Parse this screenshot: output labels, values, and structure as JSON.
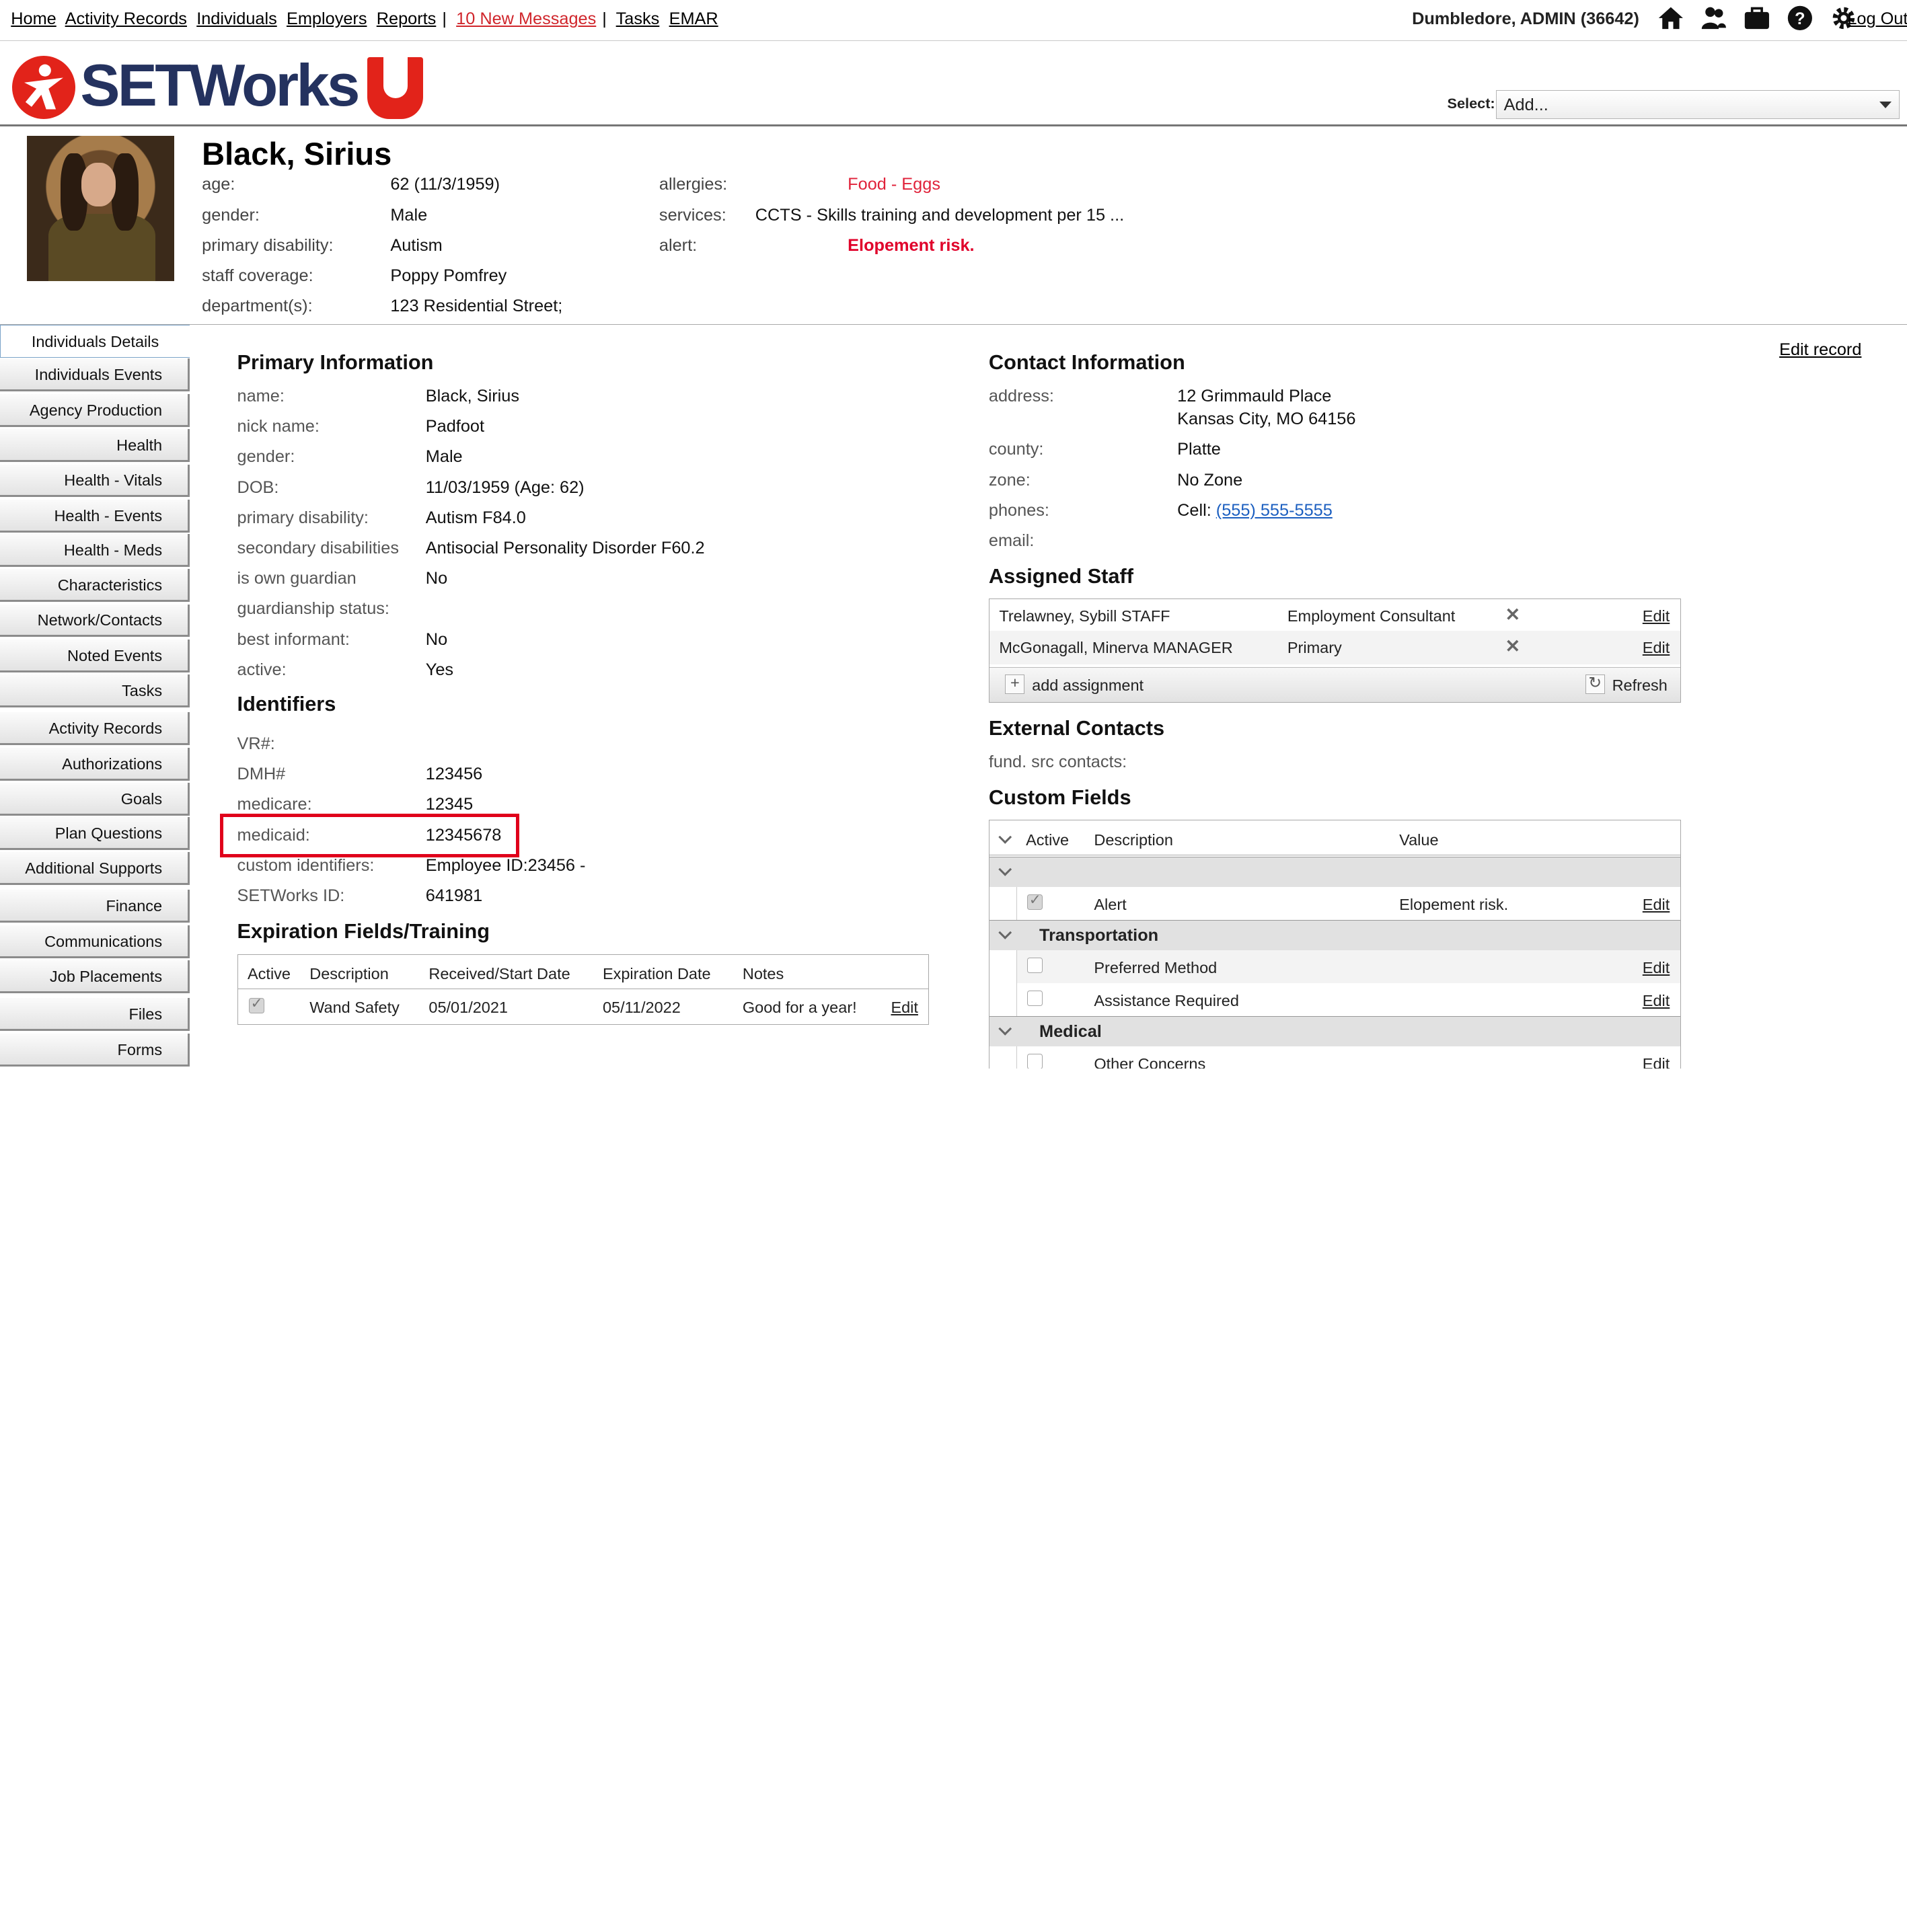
{
  "topnav": {
    "links": [
      "Home",
      "Activity Records",
      "Individuals",
      "Employers",
      "Reports"
    ],
    "messages": "10 New Messages",
    "links2": [
      "Tasks",
      "EMAR"
    ],
    "user": "Dumbledore, ADMIN  (36642)",
    "icons": [
      "home-icon",
      "users-icon",
      "briefcase-icon",
      "help-icon",
      "gear-icon"
    ],
    "logout": "Log Out"
  },
  "logo": {
    "word": "SETWorks"
  },
  "select": {
    "label": "Select:",
    "value": "Add..."
  },
  "individual": {
    "name": "Black, Sirius",
    "fields_left": [
      {
        "label": "age:",
        "value": "62 (11/3/1959)"
      },
      {
        "label": "gender:",
        "value": "Male"
      },
      {
        "label": "primary disability:",
        "value": "Autism"
      },
      {
        "label": "staff coverage:",
        "value": "Poppy Pomfrey"
      },
      {
        "label": "department(s):",
        "value": "123 Residential Street;"
      }
    ],
    "fields_right": [
      {
        "label": "allergies:",
        "value": "Food - Eggs"
      },
      {
        "label": "services:",
        "value": "CCTS - Skills training and development per 15 ..."
      },
      {
        "label": "alert:",
        "value": "Elopement risk."
      }
    ]
  },
  "sidenav": [
    "Individuals Details",
    "Individuals Events",
    "Agency Production",
    "Health",
    "Health - Vitals",
    "Health - Events",
    "Health - Meds",
    "Characteristics",
    "Network/Contacts",
    "Noted Events",
    "Tasks",
    "Activity Records",
    "Authorizations",
    "Goals",
    "Plan Questions",
    "Additional Supports",
    "Finance",
    "Communications",
    "Job Placements",
    "Files",
    "Forms"
  ],
  "edit_record": "Edit record",
  "primary": {
    "title": "Primary Information",
    "rows": [
      {
        "label": "name:",
        "value": "Black, Sirius"
      },
      {
        "label": "nick name:",
        "value": "Padfoot"
      },
      {
        "label": "gender:",
        "value": "Male"
      },
      {
        "label": "DOB:",
        "value": "11/03/1959 (Age: 62)"
      },
      {
        "label": "primary disability:",
        "value": "Autism F84.0"
      },
      {
        "label": "secondary disabilities",
        "value": "Antisocial Personality Disorder F60.2"
      },
      {
        "label": "is own guardian",
        "value": "No"
      },
      {
        "label": "guardianship status:",
        "value": ""
      },
      {
        "label": "best informant:",
        "value": "No"
      },
      {
        "label": "active:",
        "value": "Yes"
      }
    ]
  },
  "identifiers": {
    "title": "Identifiers",
    "rows": [
      {
        "label": "VR#:",
        "value": ""
      },
      {
        "label": "DMH#",
        "value": "123456"
      },
      {
        "label": "medicare:",
        "value": "12345"
      },
      {
        "label": "medicaid:",
        "value": "12345678"
      },
      {
        "label": "custom identifiers:",
        "value": "Employee ID:23456 -"
      },
      {
        "label": "SETWorks ID:",
        "value": "641981"
      }
    ]
  },
  "expiration": {
    "title": "Expiration Fields/Training",
    "headers": [
      "Active",
      "Description",
      "Received/Start Date",
      "Expiration Date",
      "Notes"
    ],
    "row": {
      "description": "Wand Safety",
      "start": "05/01/2021",
      "expiration": "05/11/2022",
      "notes": "Good for a year!",
      "edit": "Edit"
    }
  },
  "contact": {
    "title": "Contact Information",
    "address_label": "address:",
    "address1": "12 Grimmauld Place",
    "address2": "Kansas City, MO 64156",
    "county_label": "county:",
    "county": "Platte",
    "zone_label": "zone:",
    "zone": "No Zone",
    "phones_label": "phones:",
    "phone_prefix": "Cell:",
    "phone": "(555) 555-5555",
    "email_label": "email:"
  },
  "assigned": {
    "title": "Assigned Staff",
    "rows": [
      {
        "name": "Trelawney, Sybill STAFF",
        "role": "Employment Consultant",
        "edit": "Edit"
      },
      {
        "name": "McGonagall, Minerva MANAGER",
        "role": "Primary",
        "edit": "Edit"
      }
    ],
    "add": "add assignment",
    "refresh": "Refresh"
  },
  "external": {
    "title": "External Contacts",
    "label": "fund. src contacts:"
  },
  "custom": {
    "title": "Custom Fields",
    "headers": [
      "Active",
      "Description",
      "Value"
    ],
    "group1_row": {
      "description": "Alert",
      "value": "Elopement risk.",
      "edit": "Edit"
    },
    "group2": "Transportation",
    "group2_rows": [
      {
        "description": "Preferred Method",
        "edit": "Edit"
      },
      {
        "description": "Assistance Required",
        "edit": "Edit"
      }
    ],
    "group3": "Medical",
    "group3_rows": [
      {
        "description": "Other Concerns",
        "edit": "Edit"
      }
    ]
  }
}
